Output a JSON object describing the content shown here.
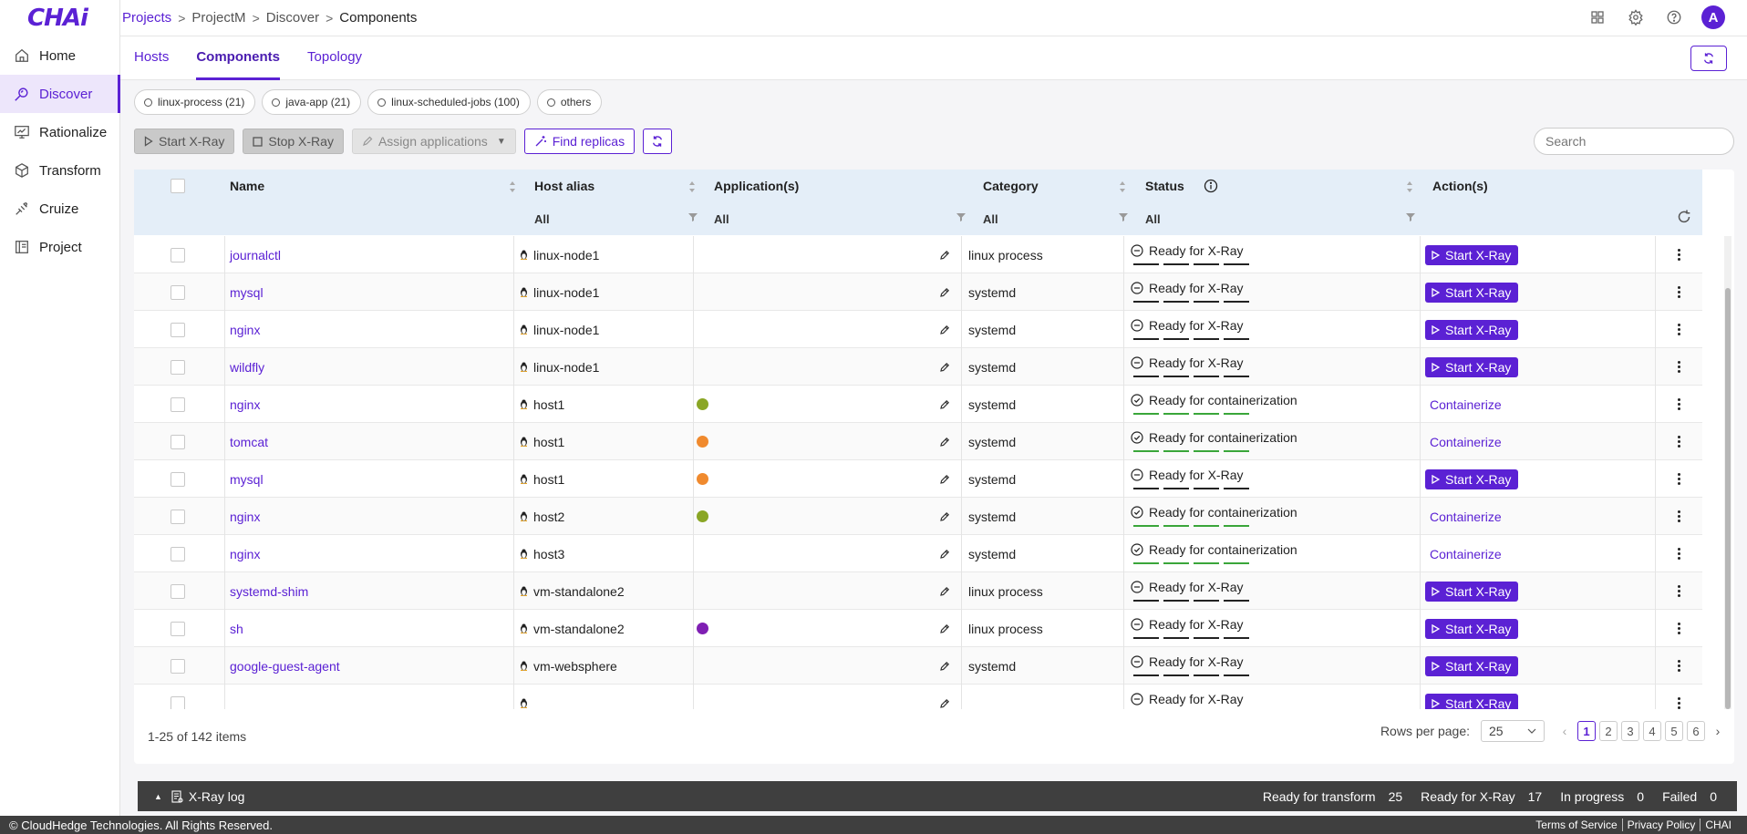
{
  "app": {
    "logo": "CHAi"
  },
  "breadcrumb": [
    "Projects",
    "ProjectM",
    "Discover",
    "Components"
  ],
  "sidebar": {
    "items": [
      {
        "label": "Home",
        "icon": "home-icon"
      },
      {
        "label": "Discover",
        "icon": "discover-icon",
        "active": true
      },
      {
        "label": "Rationalize",
        "icon": "rationalize-icon"
      },
      {
        "label": "Transform",
        "icon": "cube-icon"
      },
      {
        "label": "Cruize",
        "icon": "cruize-icon"
      },
      {
        "label": "Project",
        "icon": "project-icon"
      }
    ]
  },
  "user": {
    "avatar": "A"
  },
  "tabs": [
    "Hosts",
    "Components",
    "Topology"
  ],
  "active_tab": "Components",
  "chips": [
    "linux-process (21)",
    "java-app (21)",
    "linux-scheduled-jobs (100)",
    "others"
  ],
  "toolbar": {
    "start": "Start X-Ray",
    "stop": "Stop X-Ray",
    "assign": "Assign applications",
    "find": "Find replicas",
    "search_placeholder": "Search"
  },
  "table": {
    "columns": [
      "Name",
      "Host alias",
      "Application(s)",
      "Category",
      "Status",
      "Action(s)"
    ],
    "filters": [
      "All",
      "All",
      "All",
      "All"
    ],
    "rows": [
      {
        "name": "journalctl",
        "host": "linux-node1",
        "app": "",
        "category": "linux process",
        "status": "Ready for X-Ray",
        "kind": "xray",
        "action": "Start X-Ray"
      },
      {
        "name": "mysql",
        "host": "linux-node1",
        "app": "",
        "category": "systemd",
        "status": "Ready for X-Ray",
        "kind": "xray",
        "action": "Start X-Ray"
      },
      {
        "name": "nginx",
        "host": "linux-node1",
        "app": "",
        "category": "systemd",
        "status": "Ready for X-Ray",
        "kind": "xray",
        "action": "Start X-Ray"
      },
      {
        "name": "wildfly",
        "host": "linux-node1",
        "app": "",
        "category": "systemd",
        "status": "Ready for X-Ray",
        "kind": "xray",
        "action": "Start X-Ray"
      },
      {
        "name": "nginx",
        "host": "host1",
        "app": "#8aa625",
        "category": "systemd",
        "status": "Ready for containerization",
        "kind": "cont",
        "action": "Containerize"
      },
      {
        "name": "tomcat",
        "host": "host1",
        "app": "#f08a2e",
        "category": "systemd",
        "status": "Ready for containerization",
        "kind": "cont",
        "action": "Containerize"
      },
      {
        "name": "mysql",
        "host": "host1",
        "app": "#f08a2e",
        "category": "systemd",
        "status": "Ready for X-Ray",
        "kind": "xray",
        "action": "Start X-Ray"
      },
      {
        "name": "nginx",
        "host": "host2",
        "app": "#8aa625",
        "category": "systemd",
        "status": "Ready for containerization",
        "kind": "cont",
        "action": "Containerize"
      },
      {
        "name": "nginx",
        "host": "host3",
        "app": "",
        "category": "systemd",
        "status": "Ready for containerization",
        "kind": "cont",
        "action": "Containerize"
      },
      {
        "name": "systemd-shim",
        "host": "vm-standalone2",
        "app": "",
        "category": "linux process",
        "status": "Ready for X-Ray",
        "kind": "xray",
        "action": "Start X-Ray"
      },
      {
        "name": "sh",
        "host": "vm-standalone2",
        "app": "#7f1fb3",
        "category": "linux process",
        "status": "Ready for X-Ray",
        "kind": "xray",
        "action": "Start X-Ray"
      },
      {
        "name": "google-guest-agent",
        "host": "vm-websphere",
        "app": "",
        "category": "systemd",
        "status": "Ready for X-Ray",
        "kind": "xray",
        "action": "Start X-Ray"
      },
      {
        "name": "",
        "host": "",
        "app": "",
        "category": "",
        "status": "Ready for X-Ray",
        "kind": "xray",
        "action": "Start X-Ray"
      }
    ]
  },
  "pagination": {
    "summary": "1-25 of 142 items",
    "rows_label": "Rows per page:",
    "rows_value": "25",
    "pages": [
      "1",
      "2",
      "3",
      "4",
      "5",
      "6"
    ],
    "current": "1"
  },
  "xray_log": {
    "label": "X-Ray log",
    "stats": [
      {
        "label": "Ready for transform",
        "value": "25"
      },
      {
        "label": "Ready for X-Ray",
        "value": "17"
      },
      {
        "label": "In progress",
        "value": "0"
      },
      {
        "label": "Failed",
        "value": "0"
      }
    ]
  },
  "footer": {
    "copyright": "© CloudHedge Technologies. All Rights Reserved.",
    "links": [
      "Terms of Service",
      "Privacy Policy",
      "CHAI"
    ]
  },
  "colors": {
    "accent": "#5b21d4",
    "header_bg": "#e4eef8",
    "ready_bar": "#3aa63a"
  }
}
